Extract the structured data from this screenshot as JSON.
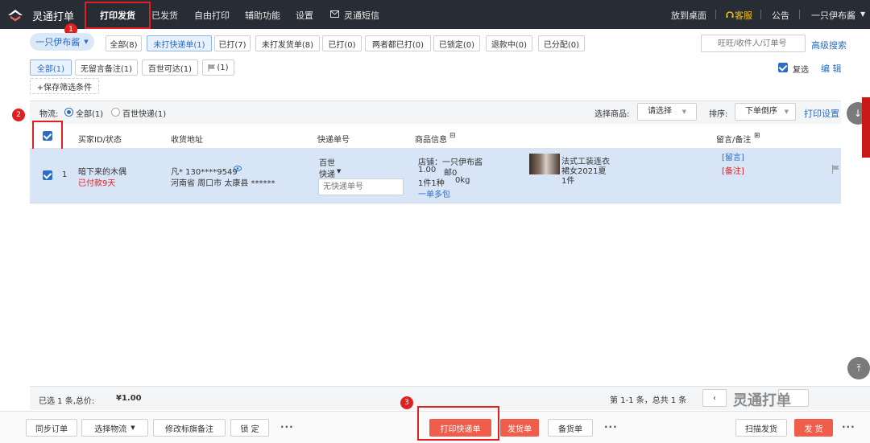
{
  "nav": {
    "app_title": "灵通打单",
    "active_tab": "打印发货",
    "tabs": [
      "已发货",
      "自由打印",
      "辅助功能",
      "设置"
    ],
    "sms": "灵通短信",
    "right": {
      "desktop": "放到桌面",
      "service": "客服",
      "notice": "公告",
      "user": "一只伊布酱"
    }
  },
  "annotations": [
    "1",
    "2",
    "3"
  ],
  "store_select": "一只伊布酱",
  "order_tabs": [
    "全部(8)",
    "未打快递单(1)",
    "已打(7)",
    "未打发货单(8)",
    "已打(0)",
    "两者都已打(0)",
    "已锁定(0)",
    "退款中(0)",
    "已分配(0)"
  ],
  "search": {
    "placeholder": "旺旺/收件人/订单号",
    "advanced": "高级搜索"
  },
  "sub_filters": [
    "全部(1)",
    "无留言备注(1)",
    "百世可达(1)",
    "(1)"
  ],
  "multi_select": "复选",
  "edit": "编 辑",
  "save_filter": "+保存筛选条件",
  "logistics": {
    "label": "物流:",
    "all": "全部(1)",
    "bestway": "百世快递(1)"
  },
  "goods": {
    "label": "选择商品:",
    "value": "请选择"
  },
  "sort": {
    "label": "排序:",
    "value": "下单倒序"
  },
  "print_settings": "打印设置",
  "table": {
    "headers": [
      "买家ID/状态",
      "收货地址",
      "快递单号",
      "商品信息",
      "留言/备注"
    ],
    "row": {
      "index": "1",
      "buyer": "暗下来的木偶",
      "status": "已付款9天",
      "recipient": "凡* 130****9549",
      "address": "河南省 周口市 太康县 ******",
      "courier_line1": "百世",
      "courier_line2": "快递",
      "tracking_placeholder": "无快递单号",
      "shop": "店铺：一只伊布酱",
      "price": "1.00",
      "shipping": "邮0",
      "qty": "1件1种",
      "weight": "0kg",
      "split": "一单多包",
      "item_title_1": "法式工装连衣",
      "item_title_2": "裙女2021夏",
      "item_count": "1件",
      "message": "[留言]",
      "remark": "[备注]"
    }
  },
  "summary": {
    "selected": "已选 1 条,总价:",
    "total": "¥1.00",
    "pagination": "第 1-1 条，总共 1 条"
  },
  "bottom": {
    "sync": "同步订单",
    "choose_logistics": "选择物流",
    "modify": "修改标旗备注",
    "lock": "锁 定",
    "print_express": "打印快递单",
    "print_invoice": "发货单",
    "picking": "备货单",
    "scan_ship": "扫描发货",
    "ship": "发 货"
  },
  "watermark": "灵通打单"
}
